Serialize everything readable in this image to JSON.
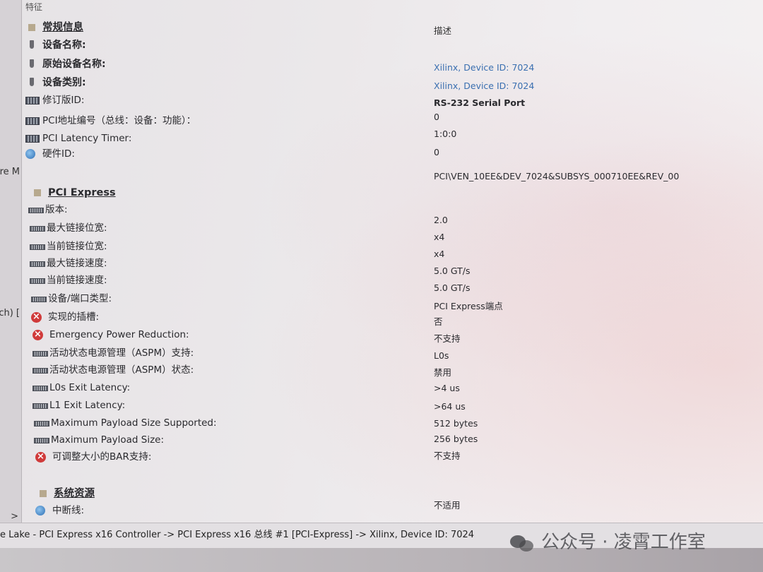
{
  "header": {
    "col1": "特征",
    "col2": "描述"
  },
  "left_pane": {
    "cut1": "re M",
    "cut2": "ch) [",
    "arrow": ">"
  },
  "rows": [
    {
      "icon": "folder-icon",
      "type": "group",
      "label": "常规信息",
      "value": ""
    },
    {
      "icon": "plug-icon",
      "type": "subgroup",
      "label": "设备名称:",
      "value": ""
    },
    {
      "icon": "plug-icon",
      "type": "subgroup",
      "label": "原始设备名称:",
      "value": "Xilinx, Device ID: 7024",
      "link": true
    },
    {
      "icon": "plug-icon",
      "type": "subgroup",
      "label": "设备类别:",
      "value": "Xilinx, Device ID: 7024",
      "link": true
    },
    {
      "icon": "card-icon",
      "type": "item",
      "label": "修订版ID:",
      "value": "RS-232 Serial Port",
      "bold": true
    },
    {
      "icon": "card-icon",
      "type": "item",
      "label": "PCI地址编号（总线：设备：功能）：",
      "value": "0"
    },
    {
      "icon": "card-icon",
      "type": "item",
      "label": "PCI Latency Timer:",
      "value": "1:0:0"
    },
    {
      "icon": "globe-icon",
      "type": "item",
      "label": "硬件ID:",
      "value": "0"
    },
    {
      "icon": "",
      "type": "item",
      "label": "",
      "value": "PCI\\VEN_10EE&DEV_7024&SUBSYS_000710EE&REV_00"
    },
    {
      "icon": "folder-icon",
      "type": "group",
      "label": "PCI Express",
      "value": ""
    },
    {
      "icon": "slot-icon",
      "type": "item",
      "label": "版本:",
      "value": ""
    },
    {
      "icon": "slot-icon",
      "type": "item",
      "label": "最大链接位宽:",
      "value": "2.0"
    },
    {
      "icon": "slot-icon",
      "type": "item",
      "label": "当前链接位宽:",
      "value": "x4"
    },
    {
      "icon": "slot-icon",
      "type": "item",
      "label": "最大链接速度:",
      "value": "x4"
    },
    {
      "icon": "slot-icon",
      "type": "item",
      "label": "当前链接速度:",
      "value": "5.0 GT/s"
    },
    {
      "icon": "slot-icon",
      "type": "item",
      "label": "设备/端口类型:",
      "value": "5.0 GT/s"
    },
    {
      "icon": "x-icon",
      "type": "item",
      "label": "实现的插槽:",
      "value": "PCI Express端点"
    },
    {
      "icon": "x-icon",
      "type": "item",
      "label": "Emergency Power Reduction:",
      "value": "否"
    },
    {
      "icon": "slot-icon",
      "type": "item",
      "label": "活动状态电源管理（ASPM）支持:",
      "value": "不支持"
    },
    {
      "icon": "slot-icon",
      "type": "item",
      "label": "活动状态电源管理（ASPM）状态:",
      "value": "L0s"
    },
    {
      "icon": "slot-icon",
      "type": "item",
      "label": "L0s Exit Latency:",
      "value": "禁用"
    },
    {
      "icon": "slot-icon",
      "type": "item",
      "label": "L1 Exit Latency:",
      "value": ">4 us"
    },
    {
      "icon": "slot-icon",
      "type": "item",
      "label": "Maximum Payload Size Supported:",
      "value": ">64 us"
    },
    {
      "icon": "slot-icon",
      "type": "item",
      "label": "Maximum Payload Size:",
      "value": "512 bytes"
    },
    {
      "icon": "x-icon",
      "type": "item",
      "label": "可调整大小的BAR支持:",
      "value": "256 bytes"
    },
    {
      "icon": "",
      "type": "item",
      "label": "",
      "value": "不支持"
    },
    {
      "icon": "folder-icon",
      "type": "group",
      "label": "系统资源",
      "value": ""
    },
    {
      "icon": "globe-icon",
      "type": "item",
      "label": "中断线:",
      "value": "不适用"
    }
  ],
  "status_bar": {
    "path": "e Lake - PCI Express x16 Controller -> PCI Express x16 总线 #1 [PCI-Express] -> Xilinx, Device ID: 7024"
  },
  "watermark": {
    "text": "公众号 · 凌霄工作室"
  }
}
